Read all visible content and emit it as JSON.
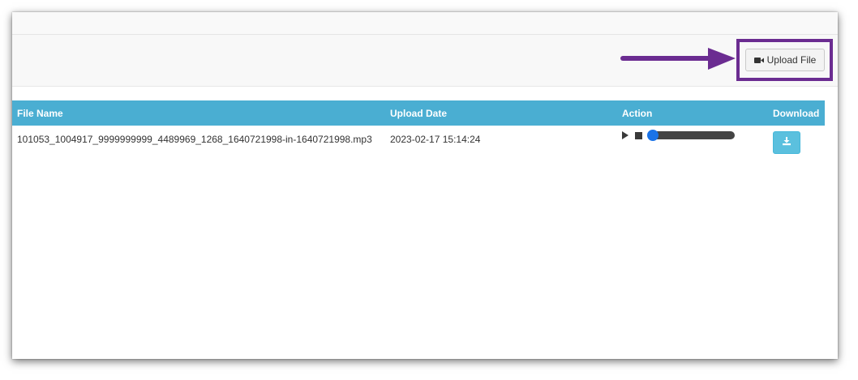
{
  "toolbar": {
    "upload_label": "Upload File",
    "upload_icon": "video-camera-icon"
  },
  "table": {
    "headers": [
      "File Name",
      "Upload Date",
      "Action",
      "Download"
    ],
    "rows": [
      {
        "file_name": "101053_1004917_9999999999_4489969_1268_1640721998-in-1640721998.mp3",
        "upload_date": "2023-02-17 15:14:24"
      }
    ]
  },
  "player": {
    "progress": 0
  },
  "colors": {
    "header_bg": "#4aaed2",
    "highlight": "#6b2c91",
    "download_bg": "#5bc0de",
    "seek_knob": "#1a73e8"
  }
}
